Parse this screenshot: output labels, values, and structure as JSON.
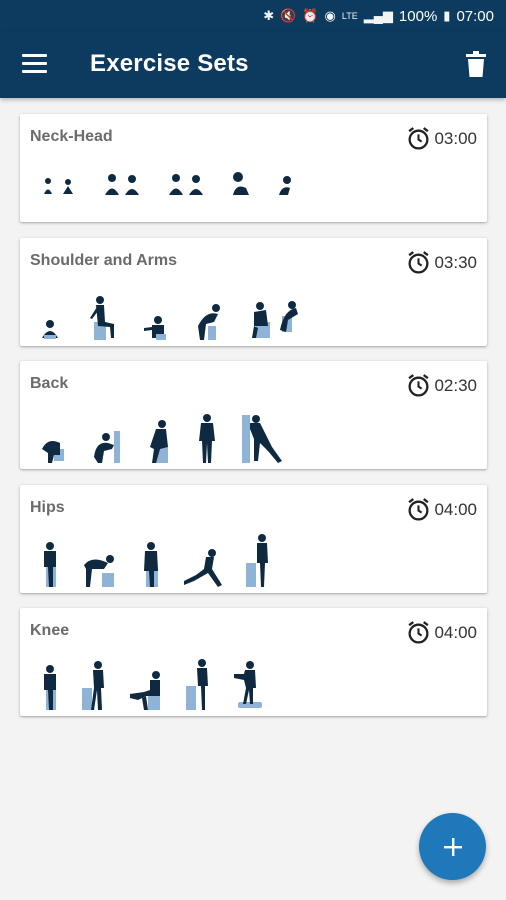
{
  "status_bar": {
    "battery": "100%",
    "time": "07:00",
    "network": "LTE"
  },
  "app_bar": {
    "title": "Exercise Sets"
  },
  "exercise_sets": [
    {
      "title": "Neck-Head",
      "duration": "03:00"
    },
    {
      "title": "Shoulder and Arms",
      "duration": "03:30"
    },
    {
      "title": "Back",
      "duration": "02:30"
    },
    {
      "title": "Hips",
      "duration": "04:00"
    },
    {
      "title": "Knee",
      "duration": "04:00"
    }
  ],
  "colors": {
    "primary": "#0d3a5f",
    "accent": "#1f78b9",
    "figure": "#0f2a40",
    "prop": "#8fb3d6"
  },
  "icons": {
    "menu": "hamburger-menu-icon",
    "delete": "trash-icon",
    "duration": "alarm-clock-icon",
    "add": "plus-icon"
  }
}
